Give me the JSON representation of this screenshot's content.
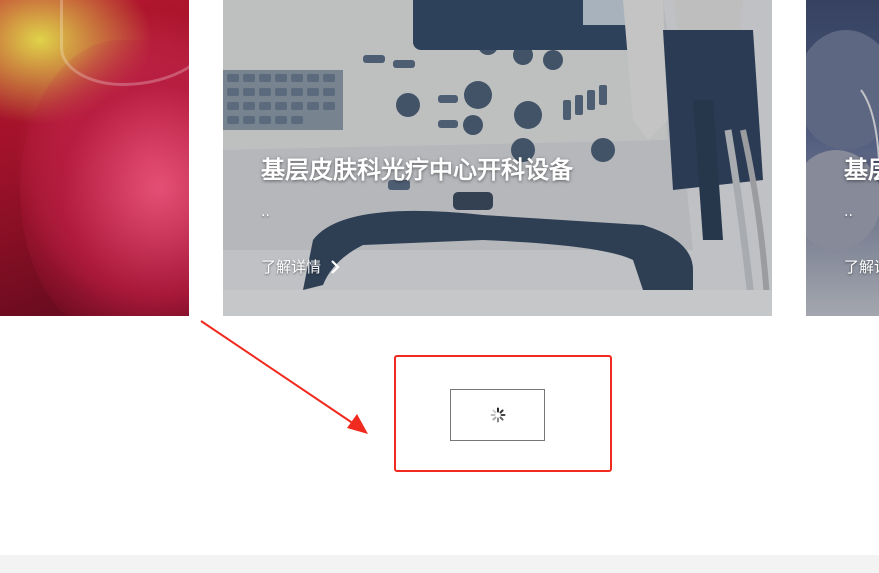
{
  "carousel": {
    "slides": [
      {
        "title": "",
        "description": "",
        "more_label": ""
      },
      {
        "title": "基层皮肤科光疗中心开科设备",
        "description": "..",
        "more_label": "了解详情"
      },
      {
        "title": "基层",
        "description": "..",
        "more_label": "了解详"
      }
    ]
  },
  "colors": {
    "annotation_red": "#f02a1e",
    "footer_gray": "#f3f3f3"
  },
  "icons": {
    "more_arrow": "chevron-right-icon",
    "loading": "spinner-icon",
    "annotation": "red-arrow-icon"
  }
}
